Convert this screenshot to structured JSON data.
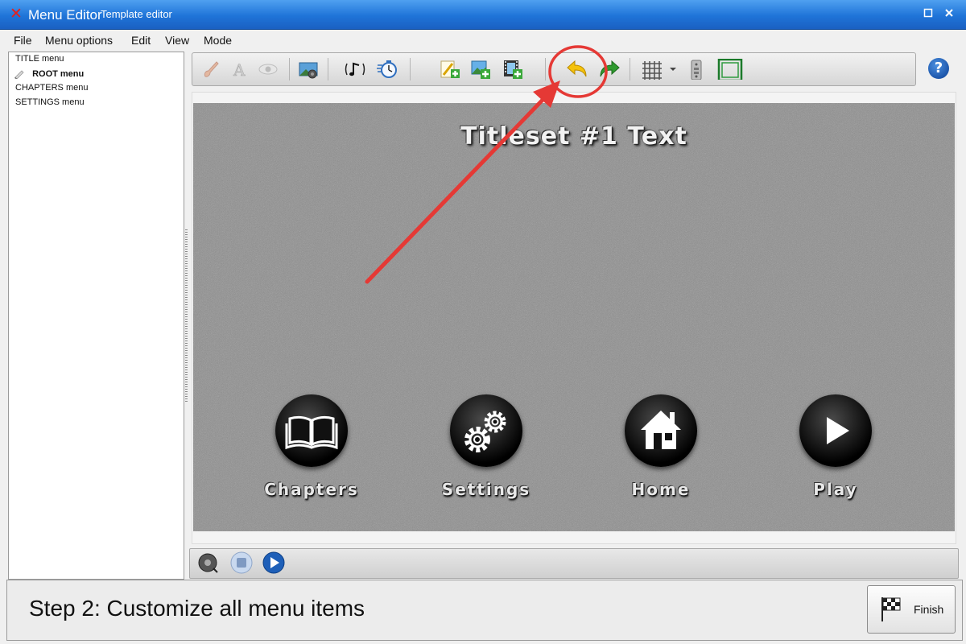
{
  "window": {
    "app_title": "Menu Editor",
    "subtitle": "Template editor",
    "app_icon": "x-logo-icon",
    "buttons": [
      "restore-icon",
      "close-icon"
    ]
  },
  "menubar": {
    "items": [
      "File",
      "Menu options",
      "Edit",
      "View",
      "Mode"
    ]
  },
  "tree": {
    "items": [
      {
        "label": "TITLE menu",
        "selected": false
      },
      {
        "label": "ROOT menu",
        "selected": true
      },
      {
        "label": "CHAPTERS menu",
        "selected": false
      },
      {
        "label": "SETTINGS menu",
        "selected": false
      }
    ]
  },
  "toolbar": {
    "buttons": [
      "paint-brush-icon",
      "text-format-icon",
      "eye-icon",
      "background-image-icon",
      "music-icon",
      "timer-icon",
      "add-text-icon",
      "add-image-icon",
      "add-video-icon",
      "undo-icon",
      "redo-icon",
      "grid-icon",
      "grid-dropdown-icon",
      "remote-control-icon",
      "safe-area-icon"
    ],
    "help": "?"
  },
  "canvas": {
    "title": "Titleset #1 Text",
    "buttons": [
      {
        "label": "Chapters",
        "icon": "book-icon"
      },
      {
        "label": "Settings",
        "icon": "gears-icon"
      },
      {
        "label": "Home",
        "icon": "home-icon"
      },
      {
        "label": "Play",
        "icon": "play-icon"
      }
    ]
  },
  "playbar": {
    "buttons": [
      "record-icon",
      "stop-icon",
      "play-icon"
    ]
  },
  "status": {
    "step_text": "Step 2: Customize all menu items",
    "finish_label": "Finish"
  },
  "annotation": {
    "color": "#e53935",
    "target": "undo-icon"
  },
  "colors": {
    "titlebar": "#1f74d8",
    "accent_green": "#2e9a2e",
    "accent_yellow": "#f5c20a",
    "annotation_red": "#e53935"
  }
}
